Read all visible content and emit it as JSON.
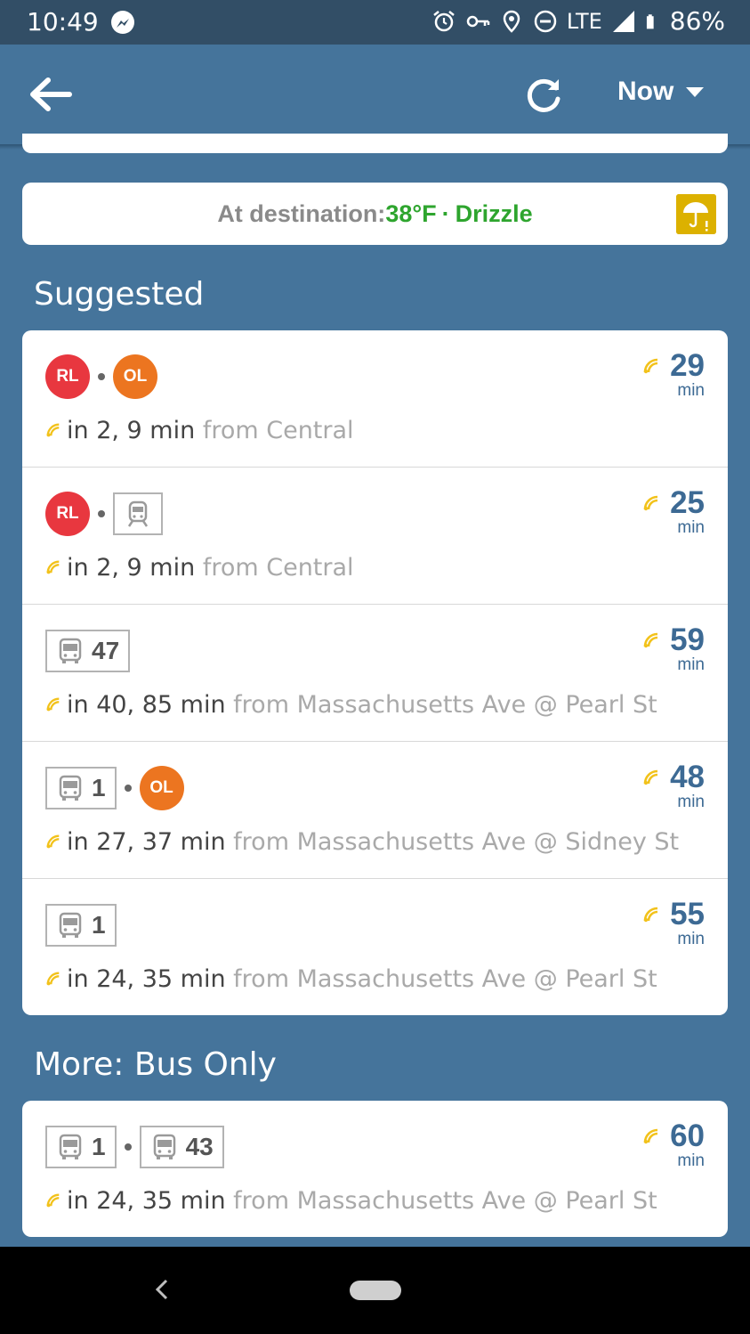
{
  "status_bar": {
    "time": "10:49",
    "network": "LTE",
    "battery": "86%",
    "icons": [
      "messenger-icon",
      "alarm-icon",
      "vpn-key-icon",
      "location-icon",
      "do-not-disturb-icon",
      "signal-icon",
      "battery-icon"
    ]
  },
  "app_bar": {
    "time_option": "Now",
    "icons": [
      "back-arrow-icon",
      "refresh-icon",
      "dropdown-caret-icon"
    ]
  },
  "weather": {
    "label": "At destination:",
    "temperature": "38°F",
    "separator": "·",
    "condition": "Drizzle",
    "icon": "umbrella-icon",
    "icon_color": "#dcb100"
  },
  "sections": {
    "suggested": {
      "title": "Suggested",
      "routes": [
        {
          "legs": [
            {
              "type": "line",
              "label": "RL",
              "color": "#e8373f"
            },
            {
              "type": "line",
              "label": "OL",
              "color": "#ec7520"
            }
          ],
          "duration": "29",
          "duration_unit": "min",
          "departures": "in 2, 9 min",
          "origin": "from Central"
        },
        {
          "legs": [
            {
              "type": "line",
              "label": "RL",
              "color": "#e8373f"
            },
            {
              "type": "train",
              "label": ""
            }
          ],
          "duration": "25",
          "duration_unit": "min",
          "departures": "in 2, 9 min",
          "origin": "from Central"
        },
        {
          "legs": [
            {
              "type": "bus",
              "label": "47"
            }
          ],
          "duration": "59",
          "duration_unit": "min",
          "departures": "in 40, 85 min",
          "origin": "from Massachusetts Ave @ Pearl St"
        },
        {
          "legs": [
            {
              "type": "bus",
              "label": "1"
            },
            {
              "type": "line",
              "label": "OL",
              "color": "#ec7520"
            }
          ],
          "duration": "48",
          "duration_unit": "min",
          "departures": "in 27, 37 min",
          "origin": "from Massachusetts Ave @ Sidney St"
        },
        {
          "legs": [
            {
              "type": "bus",
              "label": "1"
            }
          ],
          "duration": "55",
          "duration_unit": "min",
          "departures": "in 24, 35 min",
          "origin": "from Massachusetts Ave @ Pearl St"
        }
      ]
    },
    "bus_only": {
      "title": "More: Bus Only",
      "routes": [
        {
          "legs": [
            {
              "type": "bus",
              "label": "1"
            },
            {
              "type": "bus",
              "label": "43"
            }
          ],
          "duration": "60",
          "duration_unit": "min",
          "departures": "in 24, 35 min",
          "origin": "from Massachusetts Ave @ Pearl St"
        }
      ]
    }
  },
  "colors": {
    "background": "#45749b",
    "status_bar": "#324e66",
    "duration_text": "#3d6a94",
    "realtime_indicator": "#f2c21b",
    "weather_text": "#2ea52e"
  },
  "nav_bar": {
    "icons": [
      "nav-back-icon",
      "home-pill-icon"
    ]
  }
}
